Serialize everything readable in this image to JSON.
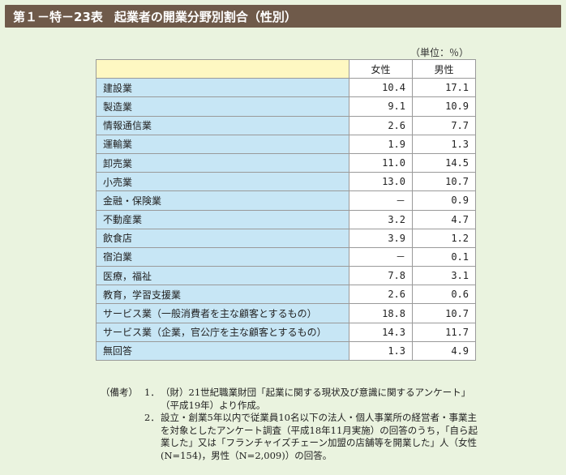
{
  "title": {
    "number": "第１－特－23表",
    "text": "起業者の開業分野別割合（性別）"
  },
  "unit": "（単位：％）",
  "table": {
    "headers": [
      "",
      "女性",
      "男性"
    ],
    "rows": [
      {
        "category": "建設業",
        "female": "10.4",
        "male": "17.1"
      },
      {
        "category": "製造業",
        "female": "9.1",
        "male": "10.9"
      },
      {
        "category": "情報通信業",
        "female": "2.6",
        "male": "7.7"
      },
      {
        "category": "運輸業",
        "female": "1.9",
        "male": "1.3"
      },
      {
        "category": "卸売業",
        "female": "11.0",
        "male": "14.5"
      },
      {
        "category": "小売業",
        "female": "13.0",
        "male": "10.7"
      },
      {
        "category": "金融・保険業",
        "female": "－",
        "male": "0.9"
      },
      {
        "category": "不動産業",
        "female": "3.2",
        "male": "4.7"
      },
      {
        "category": "飲食店",
        "female": "3.9",
        "male": "1.2"
      },
      {
        "category": "宿泊業",
        "female": "－",
        "male": "0.1"
      },
      {
        "category": "医療，福祉",
        "female": "7.8",
        "male": "3.1"
      },
      {
        "category": "教育，学習支援業",
        "female": "2.6",
        "male": "0.6"
      },
      {
        "category": "サービス業（一般消費者を主な顧客とするもの）",
        "female": "18.8",
        "male": "10.7"
      },
      {
        "category": "サービス業（企業，官公庁を主な顧客とするもの）",
        "female": "14.3",
        "male": "11.7"
      },
      {
        "category": "無回答",
        "female": "1.3",
        "male": "4.9"
      }
    ]
  },
  "notes": {
    "label": "（備考）",
    "items": [
      {
        "num": "1．",
        "text": "（財）21世紀職業財団「起業に関する現状及び意識に関するアンケート」（平成19年）より作成。"
      },
      {
        "num": "2．",
        "text": "設立・創業5年以内で従業員10名以下の法人・個人事業所の経営者・事業主を対象としたアンケート調査（平成18年11月実施）の回答のうち，「自ら起業した」又は「フランチャイズチェーン加盟の店舗等を開業した」人（女性(N=154)，男性（N=2,009)）の回答。"
      }
    ]
  }
}
